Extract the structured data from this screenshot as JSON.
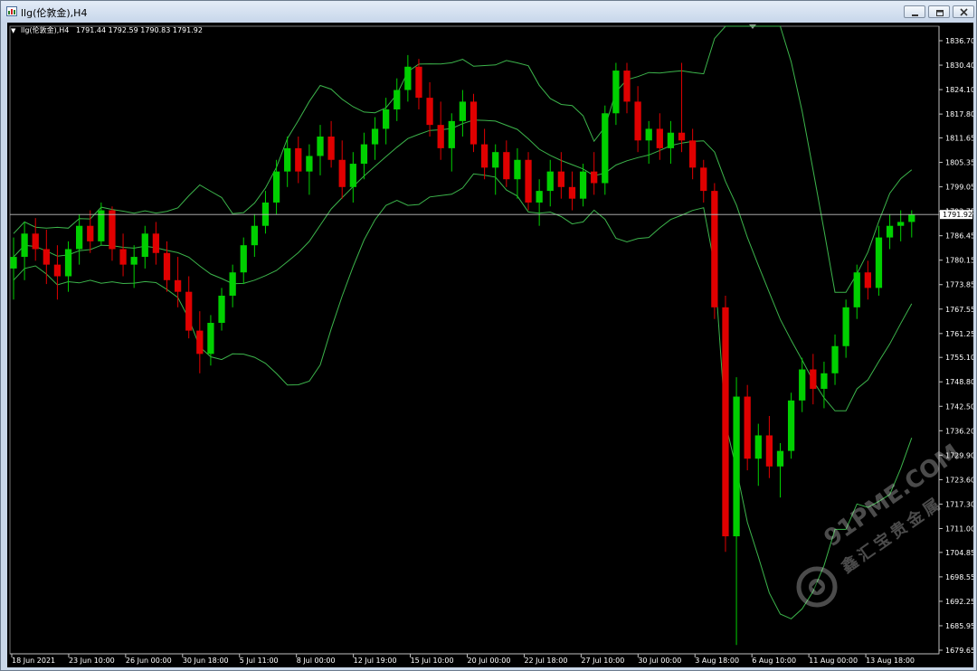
{
  "window": {
    "title": "llg(伦敦金),H4",
    "icon": "chart-window-icon",
    "buttons": [
      "minimize-icon",
      "restore-icon",
      "close-icon"
    ]
  },
  "chart_header": {
    "symbol": "llg(伦敦金),H4",
    "ohlc": "1791.44 1792.59 1790.83 1791.92"
  },
  "price_axis": {
    "ticks": [
      "1836.70",
      "1830.40",
      "1824.10",
      "1817.80",
      "1811.65",
      "1805.35",
      "1799.05",
      "1792.75",
      "1786.45",
      "1780.15",
      "1773.85",
      "1767.55",
      "1761.25",
      "1755.10",
      "1748.80",
      "1742.50",
      "1736.20",
      "1729.90",
      "1723.60",
      "1717.30",
      "1711.00",
      "1704.85",
      "1698.55",
      "1692.25",
      "1685.95",
      "1679.65"
    ],
    "current_price_label": "1791.92"
  },
  "time_axis": {
    "labels": [
      "18 Jun 2021",
      "23 Jun 10:00",
      "26 Jun 00:00",
      "30 Jun 18:00",
      "5 Jul 11:00",
      "8 Jul 00:00",
      "12 Jul 19:00",
      "15 Jul 10:00",
      "20 Jul 00:00",
      "22 Jul 18:00",
      "27 Jul 10:00",
      "30 Jul 00:00",
      "3 Aug 18:00",
      "6 Aug 10:00",
      "11 Aug 00:00",
      "13 Aug 18:00"
    ]
  },
  "colors": {
    "background": "#000000",
    "bull_candle": "#00d000",
    "bear_candle": "#e00000",
    "bollinger": "#3cb44b",
    "grid_line": "#c0c0c0",
    "text": "#ffffff"
  },
  "watermark": {
    "domain": "91PME.COM",
    "text_cn": "鑫汇宝贵金属"
  },
  "chart_data": {
    "type": "candlestick",
    "title": "llg(伦敦金),H4",
    "indicator": "Bollinger Bands",
    "ylim": [
      1679.65,
      1839.5
    ],
    "last_close": 1791.92,
    "candles": [
      [
        1778,
        1786,
        1770,
        1781
      ],
      [
        1781,
        1790,
        1775,
        1787
      ],
      [
        1787,
        1791,
        1780,
        1783
      ],
      [
        1783,
        1788,
        1774,
        1779
      ],
      [
        1779,
        1784,
        1770,
        1776
      ],
      [
        1776,
        1785,
        1772,
        1783
      ],
      [
        1783,
        1792,
        1779,
        1789
      ],
      [
        1789,
        1793,
        1782,
        1785
      ],
      [
        1785,
        1795,
        1784,
        1793
      ],
      [
        1793,
        1794,
        1780,
        1783
      ],
      [
        1783,
        1787,
        1776,
        1779
      ],
      [
        1779,
        1784,
        1773,
        1781
      ],
      [
        1781,
        1789,
        1778,
        1787
      ],
      [
        1787,
        1790,
        1779,
        1782
      ],
      [
        1782,
        1785,
        1772,
        1775
      ],
      [
        1775,
        1781,
        1768,
        1772
      ],
      [
        1772,
        1776,
        1760,
        1762
      ],
      [
        1762,
        1767,
        1751,
        1756
      ],
      [
        1756,
        1766,
        1753,
        1764
      ],
      [
        1764,
        1773,
        1762,
        1771
      ],
      [
        1771,
        1779,
        1768,
        1777
      ],
      [
        1777,
        1786,
        1774,
        1784
      ],
      [
        1784,
        1792,
        1781,
        1789
      ],
      [
        1789,
        1798,
        1787,
        1795
      ],
      [
        1795,
        1806,
        1792,
        1803
      ],
      [
        1803,
        1812,
        1799,
        1809
      ],
      [
        1809,
        1812,
        1800,
        1803
      ],
      [
        1803,
        1810,
        1797,
        1807
      ],
      [
        1807,
        1815,
        1802,
        1812
      ],
      [
        1812,
        1816,
        1804,
        1806
      ],
      [
        1806,
        1811,
        1796,
        1799
      ],
      [
        1799,
        1808,
        1795,
        1805
      ],
      [
        1805,
        1813,
        1801,
        1810
      ],
      [
        1810,
        1817,
        1806,
        1814
      ],
      [
        1814,
        1822,
        1810,
        1819
      ],
      [
        1819,
        1827,
        1816,
        1824
      ],
      [
        1824,
        1833,
        1821,
        1830
      ],
      [
        1830,
        1832,
        1819,
        1822
      ],
      [
        1822,
        1826,
        1812,
        1815
      ],
      [
        1815,
        1821,
        1806,
        1809
      ],
      [
        1809,
        1818,
        1803,
        1816
      ],
      [
        1816,
        1824,
        1812,
        1821
      ],
      [
        1821,
        1823,
        1808,
        1810
      ],
      [
        1810,
        1814,
        1801,
        1804
      ],
      [
        1804,
        1810,
        1797,
        1808
      ],
      [
        1808,
        1811,
        1799,
        1801
      ],
      [
        1801,
        1809,
        1796,
        1806
      ],
      [
        1806,
        1808,
        1793,
        1795
      ],
      [
        1795,
        1801,
        1789,
        1798
      ],
      [
        1798,
        1806,
        1794,
        1803
      ],
      [
        1803,
        1808,
        1796,
        1799
      ],
      [
        1799,
        1803,
        1793,
        1796
      ],
      [
        1796,
        1805,
        1794,
        1803
      ],
      [
        1803,
        1808,
        1797,
        1800
      ],
      [
        1800,
        1820,
        1797,
        1818
      ],
      [
        1818,
        1831,
        1815,
        1829
      ],
      [
        1829,
        1831,
        1818,
        1821
      ],
      [
        1821,
        1825,
        1808,
        1811
      ],
      [
        1811,
        1816,
        1805,
        1814
      ],
      [
        1814,
        1818,
        1806,
        1809
      ],
      [
        1809,
        1816,
        1805,
        1813
      ],
      [
        1813,
        1831,
        1808,
        1811
      ],
      [
        1811,
        1814,
        1801,
        1804
      ],
      [
        1804,
        1806,
        1795,
        1798
      ],
      [
        1798,
        1800,
        1765,
        1768
      ],
      [
        1768,
        1771,
        1705,
        1709
      ],
      [
        1709,
        1750,
        1681,
        1745
      ],
      [
        1745,
        1748,
        1726,
        1729
      ],
      [
        1729,
        1738,
        1722,
        1735
      ],
      [
        1735,
        1740,
        1724,
        1727
      ],
      [
        1727,
        1733,
        1719,
        1731
      ],
      [
        1731,
        1746,
        1729,
        1744
      ],
      [
        1744,
        1755,
        1741,
        1752
      ],
      [
        1752,
        1756,
        1743,
        1747
      ],
      [
        1747,
        1754,
        1742,
        1751
      ],
      [
        1751,
        1761,
        1748,
        1758
      ],
      [
        1758,
        1770,
        1755,
        1768
      ],
      [
        1768,
        1779,
        1765,
        1777
      ],
      [
        1777,
        1780,
        1770,
        1773
      ],
      [
        1773,
        1789,
        1771,
        1786
      ],
      [
        1786,
        1792,
        1783,
        1789
      ],
      [
        1789,
        1793,
        1785,
        1790
      ],
      [
        1790,
        1793,
        1786,
        1791.92
      ]
    ]
  }
}
